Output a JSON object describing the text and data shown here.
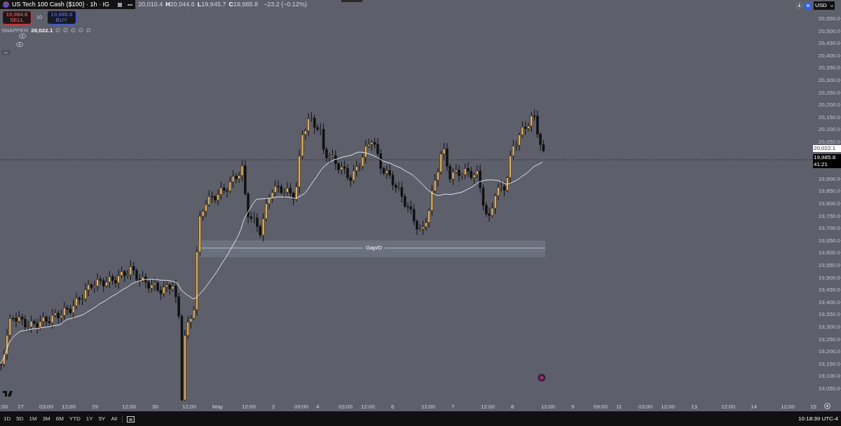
{
  "header": {
    "title": "US Tech 100 Cash ($100) · 1h · IG",
    "more": "•••",
    "ohlc": [
      {
        "value": "20,010.4"
      },
      {
        "label": "H",
        "value": "20,044.6"
      },
      {
        "label": "L",
        "value": "19,945.7"
      },
      {
        "label": "C",
        "value": "19,985.8"
      }
    ],
    "change": "−23.2 (−0.12%)"
  },
  "trade": {
    "sell": {
      "price": "19,984.6",
      "label": "SELL"
    },
    "spread": "10",
    "buy": {
      "price": "19,985.6",
      "label": "BUY"
    }
  },
  "indicator": {
    "name": "SNAPPER",
    "value": "20,022.1",
    "params": [
      "∅",
      "∅",
      "∅",
      "∅",
      "∅"
    ]
  },
  "toolbar": {
    "sync_on": true,
    "currency": "USD"
  },
  "price_axis": {
    "ticks": [
      "20,550.0",
      "20,500.0",
      "20,450.0",
      "20,400.0",
      "20,350.0",
      "20,300.0",
      "20,250.0",
      "20,200.0",
      "20,150.0",
      "20,100.0",
      "20,050.0",
      "19,900.0",
      "19,850.0",
      "19,800.0",
      "19,750.0",
      "19,700.0",
      "19,650.0",
      "19,600.0",
      "19,550.0",
      "19,500.0",
      "19,450.0",
      "19,400.0",
      "19,350.0",
      "19,300.0",
      "19,250.0",
      "19,200.0",
      "19,150.0",
      "19,100.0",
      "19,050.0"
    ],
    "ma_tag": "20,022.1",
    "last_price": "19,985.8",
    "countdown": "41:21"
  },
  "zone": {
    "label": "Gap/D"
  },
  "time_axis": [
    ":00",
    "27",
    "03:00",
    "12:00",
    "29",
    "12:00",
    "30",
    "12:00",
    "May",
    "12:00",
    "2",
    "09:00",
    "4",
    "03:00",
    "12:00",
    "6",
    "12:00",
    "7",
    "12:00",
    "8",
    "12:00",
    "9",
    "09:00",
    "11",
    "03:00",
    "12:00",
    "13",
    "12:00",
    "14",
    "12:00",
    "15"
  ],
  "range_buttons": [
    "1D",
    "5D",
    "1M",
    "3M",
    "6M",
    "YTD",
    "1Y",
    "5Y",
    "All"
  ],
  "clock": "10:18:39 UTC-4"
}
